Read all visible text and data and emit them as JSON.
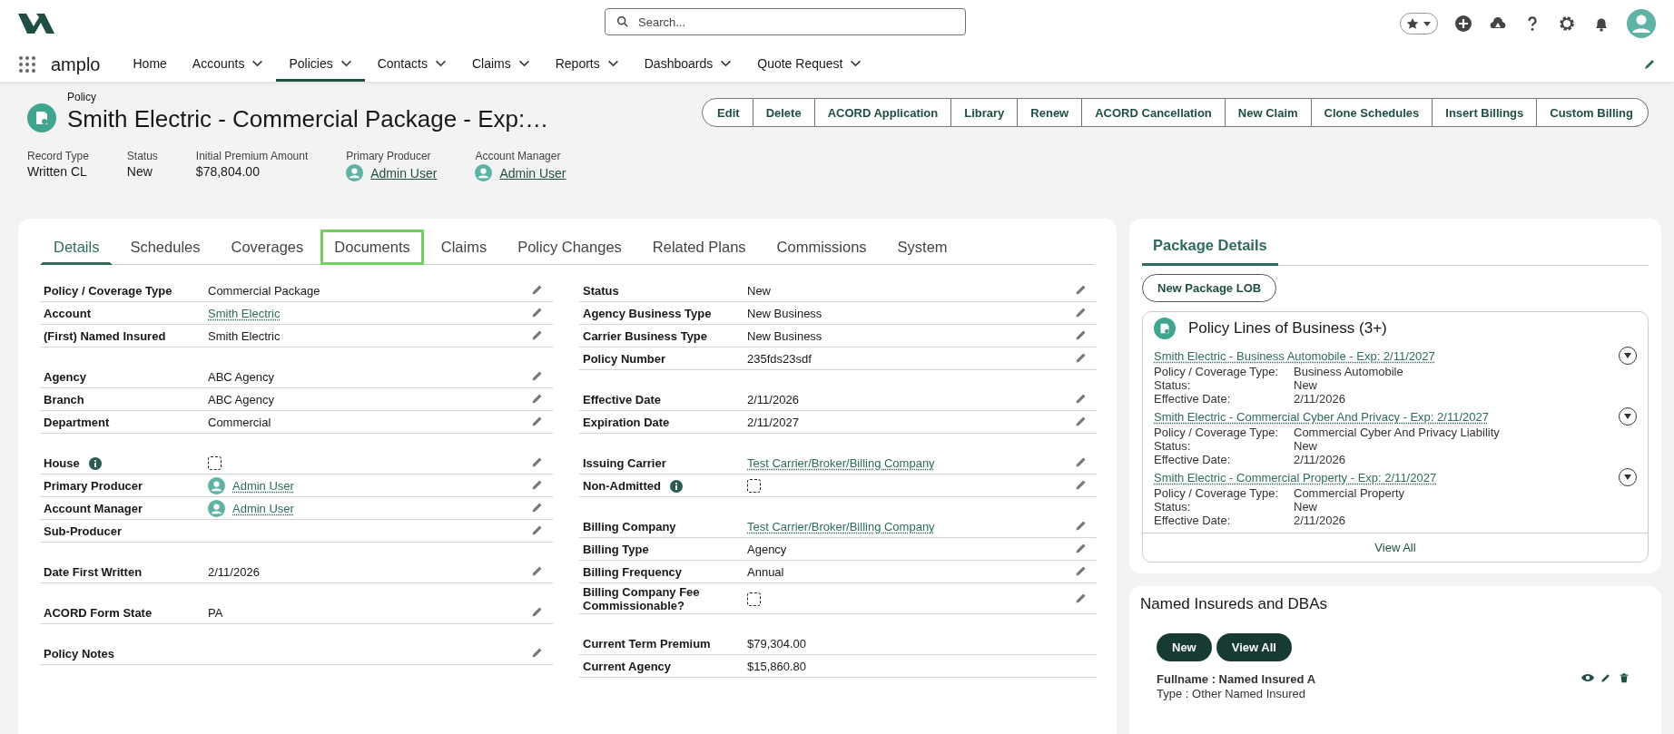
{
  "global_header": {
    "search": {
      "placeholder": "Search..."
    }
  },
  "app": {
    "name": "amplo",
    "nav": [
      {
        "label": "Home",
        "menu": false,
        "selected": false
      },
      {
        "label": "Accounts",
        "menu": true,
        "selected": false
      },
      {
        "label": "Policies",
        "menu": true,
        "selected": true
      },
      {
        "label": "Contacts",
        "menu": true,
        "selected": false
      },
      {
        "label": "Claims",
        "menu": true,
        "selected": false
      },
      {
        "label": "Reports",
        "menu": true,
        "selected": false
      },
      {
        "label": "Dashboards",
        "menu": true,
        "selected": false
      },
      {
        "label": "Quote Request",
        "menu": true,
        "selected": false
      }
    ]
  },
  "record": {
    "object": "Policy",
    "title": "Smith Electric - Commercial Package - Exp:…",
    "actions": [
      "Edit",
      "Delete",
      "ACORD Application",
      "Library",
      "Renew",
      "ACORD Cancellation",
      "New Claim",
      "Clone Schedules",
      "Insert Billings",
      "Custom Billing"
    ],
    "highlights": [
      {
        "label": "Record Type",
        "value": "Written CL",
        "kind": "text"
      },
      {
        "label": "Status",
        "value": "New",
        "kind": "text"
      },
      {
        "label": "Initial Premium Amount",
        "value": "$78,804.00",
        "kind": "text"
      },
      {
        "label": "Primary Producer",
        "value": "Admin User",
        "kind": "user"
      },
      {
        "label": "Account Manager",
        "value": "Admin User",
        "kind": "user"
      }
    ]
  },
  "details": {
    "tabs": [
      {
        "label": "Details",
        "selected": true,
        "highlighted": false
      },
      {
        "label": "Schedules",
        "selected": false,
        "highlighted": false
      },
      {
        "label": "Coverages",
        "selected": false,
        "highlighted": false
      },
      {
        "label": "Documents",
        "selected": false,
        "highlighted": true
      },
      {
        "label": "Claims",
        "selected": false,
        "highlighted": false
      },
      {
        "label": "Policy Changes",
        "selected": false,
        "highlighted": false
      },
      {
        "label": "Related Plans",
        "selected": false,
        "highlighted": false
      },
      {
        "label": "Commissions",
        "selected": false,
        "highlighted": false
      },
      {
        "label": "System",
        "selected": false,
        "highlighted": false
      }
    ],
    "columns": [
      {
        "groups": [
          {
            "fields": [
              {
                "label": "Policy / Coverage Type",
                "value": "Commercial Package",
                "kind": "text",
                "info": false,
                "editable": true
              },
              {
                "label": "Account",
                "value": "Smith Electric",
                "kind": "link",
                "info": false,
                "editable": true
              },
              {
                "label": "(First) Named Insured",
                "value": "Smith Electric",
                "kind": "text",
                "info": false,
                "editable": true
              }
            ]
          },
          {
            "fields": [
              {
                "label": "Agency",
                "value": "ABC Agency",
                "kind": "text",
                "info": false,
                "editable": true
              },
              {
                "label": "Branch",
                "value": "ABC Agency",
                "kind": "text",
                "info": false,
                "editable": true
              },
              {
                "label": "Department",
                "value": "Commercial",
                "kind": "text",
                "info": false,
                "editable": true
              }
            ]
          },
          {
            "fields": [
              {
                "label": "House",
                "kind": "checkbox",
                "checked": false,
                "info": true,
                "editable": true
              },
              {
                "label": "Primary Producer",
                "value": "Admin User",
                "kind": "user",
                "info": false,
                "editable": true
              },
              {
                "label": "Account Manager",
                "value": "Admin User",
                "kind": "user",
                "info": false,
                "editable": true
              },
              {
                "label": "Sub-Producer",
                "kind": "text",
                "info": false,
                "editable": true
              }
            ]
          },
          {
            "fields": [
              {
                "label": "Date First Written",
                "value": "2/11/2026",
                "kind": "text",
                "info": false,
                "editable": true
              }
            ]
          },
          {
            "fields": [
              {
                "label": "ACORD Form State",
                "value": "PA",
                "kind": "text",
                "info": false,
                "editable": true
              }
            ]
          },
          {
            "fields": [
              {
                "label": "Policy Notes",
                "kind": "text",
                "info": false,
                "editable": true
              }
            ]
          }
        ]
      },
      {
        "groups": [
          {
            "fields": [
              {
                "label": "Status",
                "value": "New",
                "kind": "text",
                "info": false,
                "editable": true
              },
              {
                "label": "Agency Business Type",
                "value": "New Business",
                "kind": "text",
                "info": false,
                "editable": true
              },
              {
                "label": "Carrier Business Type",
                "value": "New Business",
                "kind": "text",
                "info": false,
                "editable": true
              },
              {
                "label": "Policy Number",
                "value": "235fds23sdf",
                "kind": "text",
                "info": false,
                "editable": true
              }
            ]
          },
          {
            "fields": [
              {
                "label": "Effective Date",
                "value": "2/11/2026",
                "kind": "text",
                "info": false,
                "editable": true
              },
              {
                "label": "Expiration Date",
                "value": "2/11/2027",
                "kind": "text",
                "info": false,
                "editable": true
              }
            ]
          },
          {
            "fields": [
              {
                "label": "Issuing Carrier",
                "value": "Test Carrier/Broker/Billing Company",
                "kind": "link",
                "info": false,
                "editable": true
              },
              {
                "label": "Non-Admitted",
                "kind": "checkbox",
                "checked": false,
                "info": true,
                "editable": true
              }
            ]
          },
          {
            "fields": [
              {
                "label": "Billing Company",
                "value": "Test Carrier/Broker/Billing Company",
                "kind": "link",
                "info": false,
                "editable": true
              },
              {
                "label": "Billing Type",
                "value": "Agency",
                "kind": "text",
                "info": false,
                "editable": true
              },
              {
                "label": "Billing Frequency",
                "value": "Annual",
                "kind": "text",
                "info": false,
                "editable": true
              },
              {
                "label": "Billing Company Fee Commissionable?",
                "kind": "checkbox",
                "checked": false,
                "info": false,
                "editable": true
              }
            ]
          },
          {
            "fields": [
              {
                "label": "Current Term Premium",
                "value": "$79,304.00",
                "kind": "text",
                "info": false,
                "editable": false
              },
              {
                "label": "Current Agency",
                "value": "$15,860.80",
                "kind": "text",
                "info": false,
                "editable": false
              }
            ]
          }
        ]
      }
    ]
  },
  "package": {
    "tabs": [
      {
        "label": "Package Details",
        "selected": true
      }
    ],
    "new_button": "New Package LOB",
    "lines": {
      "title": "Policy Lines of Business (3+)",
      "view_all": "View All",
      "items": [
        {
          "name": "Smith Electric - Business Automobile - Exp: 2/11/2027",
          "fields": [
            {
              "label": "Policy / Coverage Type:",
              "value": "Business Automobile"
            },
            {
              "label": "Status:",
              "value": "New"
            },
            {
              "label": "Effective Date:",
              "value": "2/11/2026"
            }
          ]
        },
        {
          "name": "Smith Electric - Commercial Cyber And Privacy - Exp: 2/11/2027",
          "fields": [
            {
              "label": "Policy / Coverage Type:",
              "value": "Commercial Cyber And Privacy Liability"
            },
            {
              "label": "Status:",
              "value": "New"
            },
            {
              "label": "Effective Date:",
              "value": "2/11/2026"
            }
          ]
        },
        {
          "name": "Smith Electric - Commercial Property - Exp: 2/11/2027",
          "fields": [
            {
              "label": "Policy / Coverage Type:",
              "value": "Commercial Property"
            },
            {
              "label": "Status:",
              "value": "New"
            },
            {
              "label": "Effective Date:",
              "value": "2/11/2026"
            }
          ]
        }
      ]
    }
  },
  "named_insureds": {
    "title": "Named Insureds and DBAs",
    "buttons": [
      "New",
      "View All"
    ],
    "items": [
      {
        "fullname": "Fullname : Named Insured A",
        "type": "Type : Other Named Insured"
      }
    ]
  }
}
